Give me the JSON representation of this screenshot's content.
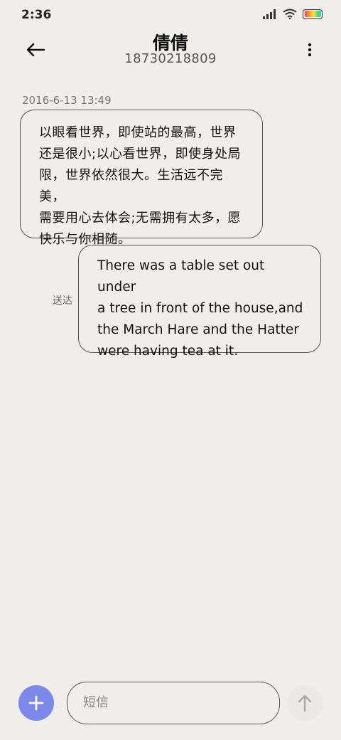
{
  "status_bar": {
    "time": "2:36",
    "icons": [
      "signal-icon",
      "wifi-icon",
      "battery-icon"
    ]
  },
  "header": {
    "contact_name": "倩倩",
    "contact_number": "18730218809",
    "back_icon": "arrow-left-icon",
    "menu_icon": "more-vertical-icon"
  },
  "messages": [
    {
      "timestamp": "2016-6-13 13:49",
      "direction": "incoming",
      "lines": [
        "以眼看世界，即使站的最高，世界",
        "还是很小;以心看世界，即使身处局",
        "限，世界依然很大。生活远不完美，",
        "需要用心去体会;无需拥有太多，愿",
        "快乐与你相随。"
      ]
    },
    {
      "direction": "outgoing",
      "status": "送达",
      "lines": [
        "There was a table set out under",
        "a tree in front of the house,and",
        "the March Hare and the Hatter",
        "were having tea at it."
      ]
    }
  ],
  "composer": {
    "placeholder": "短信",
    "value": "",
    "add_icon": "plus-icon",
    "send_icon": "arrow-up-icon"
  },
  "colors": {
    "background": "#f0eeea",
    "accent": "#7c89ea",
    "bubble_border": "#555555"
  }
}
